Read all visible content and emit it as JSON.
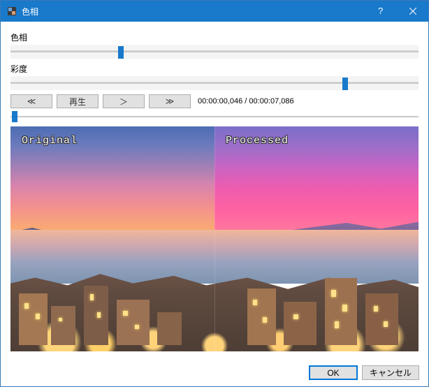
{
  "titlebar": {
    "title": "色相",
    "help_tooltip": "?",
    "close_tooltip": "×"
  },
  "sliders": {
    "hue": {
      "label": "色相",
      "position_pct": 27
    },
    "saturation": {
      "label": "彩度",
      "position_pct": 82
    }
  },
  "playback": {
    "rewind_label": "≪",
    "play_label": "再生",
    "step_label": "＞",
    "forward_label": "≫",
    "timecode": "00:00:00,046 / 00:00:07,086",
    "scrub_position_pct": 1
  },
  "preview": {
    "left_label": "Original",
    "right_label": "Processed"
  },
  "footer": {
    "ok_label": "OK",
    "cancel_label": "キャンセル"
  }
}
